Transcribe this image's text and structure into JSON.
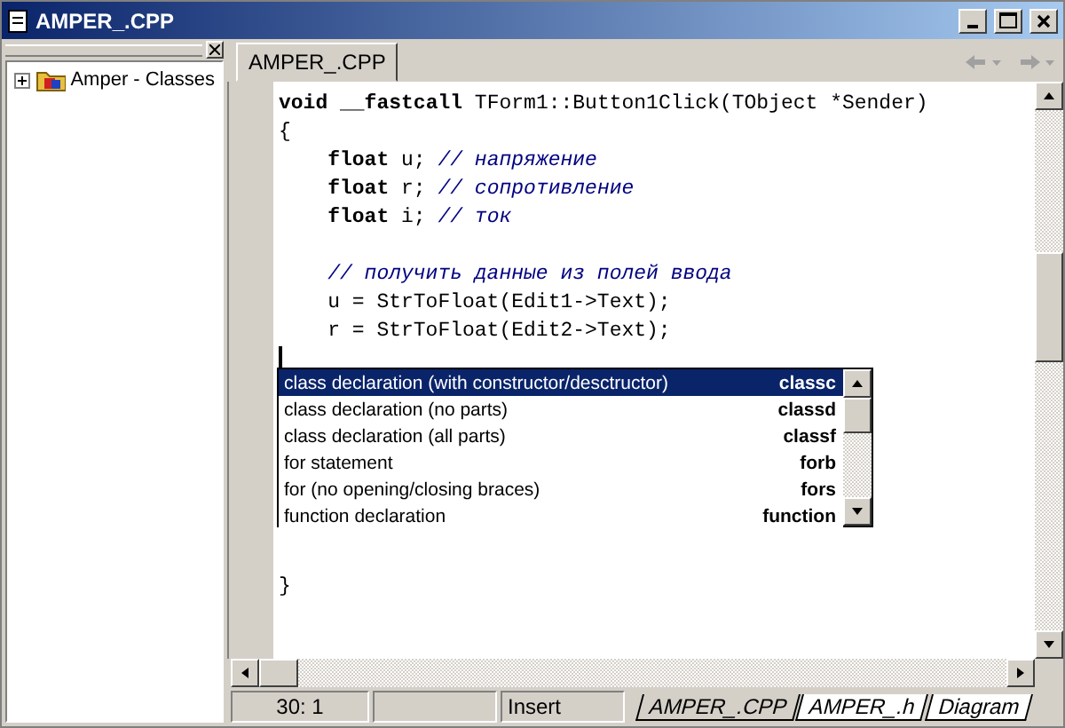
{
  "window": {
    "title": "AMPER_.CPP"
  },
  "class_explorer": {
    "tree": [
      {
        "label": "Amper - Classes",
        "expanded": false
      }
    ]
  },
  "editor_tabs": [
    {
      "label": "AMPER_.CPP",
      "selected": true
    }
  ],
  "code": [
    {
      "indented": false,
      "segments": [
        {
          "kind": "keyword",
          "text": "void __fastcall"
        },
        {
          "kind": "plain",
          "text": "TForm1::Button1Click(TObject *Sender)"
        }
      ]
    },
    {
      "indented": false,
      "segments": [
        {
          "kind": "plain",
          "text": "{"
        }
      ]
    },
    {
      "indented": true,
      "segments": [
        {
          "kind": "keyword",
          "text": "float"
        },
        {
          "kind": "plain",
          "text": "u;"
        },
        {
          "kind": "comment",
          "text": "// напряжение"
        }
      ]
    },
    {
      "indented": true,
      "segments": [
        {
          "kind": "keyword",
          "text": "float"
        },
        {
          "kind": "plain",
          "text": "r;"
        },
        {
          "kind": "comment",
          "text": "// сопротивление"
        }
      ]
    },
    {
      "indented": true,
      "segments": [
        {
          "kind": "keyword",
          "text": "float"
        },
        {
          "kind": "plain",
          "text": "i;"
        },
        {
          "kind": "comment",
          "text": "// ток"
        }
      ]
    },
    {
      "kind": "blank"
    },
    {
      "indented": true,
      "segments": [
        {
          "kind": "comment",
          "text": "// получить данные из полей ввода"
        }
      ]
    },
    {
      "indented": true,
      "segments": [
        {
          "kind": "plain",
          "text": "u = StrToFloat(Edit1->Text);"
        }
      ]
    },
    {
      "indented": true,
      "segments": [
        {
          "kind": "plain",
          "text": "r = StrToFloat(Edit2->Text);"
        }
      ]
    },
    {
      "kind": "cursor"
    },
    {
      "kind": "blank"
    },
    {
      "kind": "blank"
    },
    {
      "kind": "blank"
    },
    {
      "kind": "blank"
    },
    {
      "kind": "blank"
    },
    {
      "kind": "blank"
    },
    {
      "kind": "blank"
    },
    {
      "indented": false,
      "segments": [
        {
          "kind": "plain",
          "text": "}"
        }
      ]
    }
  ],
  "completion": [
    {
      "description": "class declaration (with constructor/desctructor)",
      "shortcut": "classc",
      "selected": true
    },
    {
      "description": "class declaration (no parts)",
      "shortcut": "classd",
      "selected": false
    },
    {
      "description": "class declaration (all parts)",
      "shortcut": "classf",
      "selected": false
    },
    {
      "description": "for statement",
      "shortcut": "forb",
      "selected": false
    },
    {
      "description": "for (no opening/closing braces)",
      "shortcut": "fors",
      "selected": false
    },
    {
      "description": "function declaration",
      "shortcut": "function",
      "selected": false
    }
  ],
  "status_bar": {
    "position": "30:  1",
    "mode": "Insert"
  },
  "file_tabs": [
    {
      "label": "AMPER_.CPP",
      "selected": true
    },
    {
      "label": "AMPER_.h",
      "selected": false
    },
    {
      "label": "Diagram",
      "selected": false
    }
  ]
}
